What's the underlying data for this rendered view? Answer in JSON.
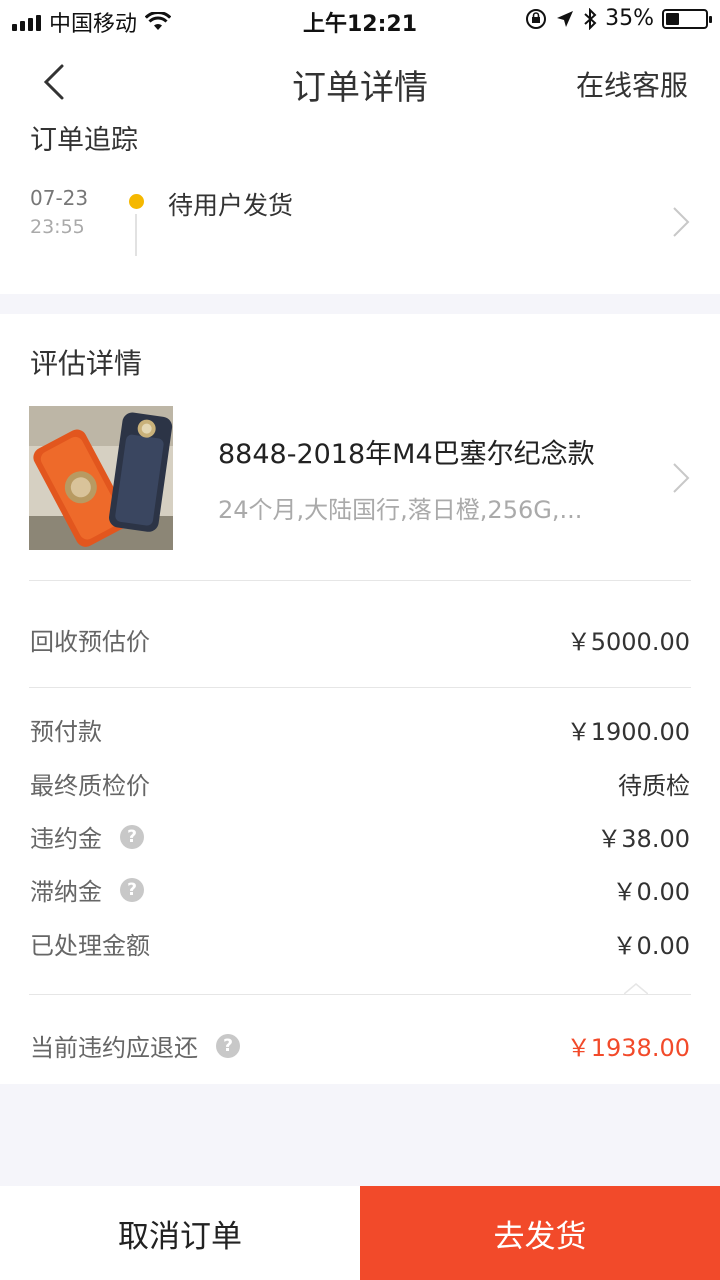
{
  "status_bar": {
    "carrier": "中国移动",
    "time": "上午12:21",
    "battery": "35%",
    "battery_level": 0.35
  },
  "nav": {
    "title": "订单详情",
    "right_label": "在线客服"
  },
  "tracking": {
    "title": "订单追踪",
    "date": "07-23",
    "time": "23:55",
    "status": "待用户发货",
    "dot_color": "#f5b800"
  },
  "assessment": {
    "title": "评估详情",
    "product": {
      "name": "8848-2018年M4巴塞尔纪念款",
      "spec": "24个月,大陆国行,落日橙,256G,..."
    },
    "estimate_label": "回收预估价",
    "estimate_value": "￥5000.00",
    "rows": [
      {
        "label": "预付款",
        "value": "￥1900.00"
      },
      {
        "label": "最终质检价",
        "value": "待质检"
      },
      {
        "label": "违约金",
        "value": "￥38.00"
      },
      {
        "label": "滞纳金",
        "value": "￥0.00"
      },
      {
        "label": "已处理金额",
        "value": "￥0.00"
      }
    ],
    "refund_label": "当前违约应退还",
    "refund_value": "￥1938.00",
    "accent_color": "#f24a2a"
  },
  "bottom": {
    "cancel_label": "取消订单",
    "ship_label": "去发货"
  }
}
